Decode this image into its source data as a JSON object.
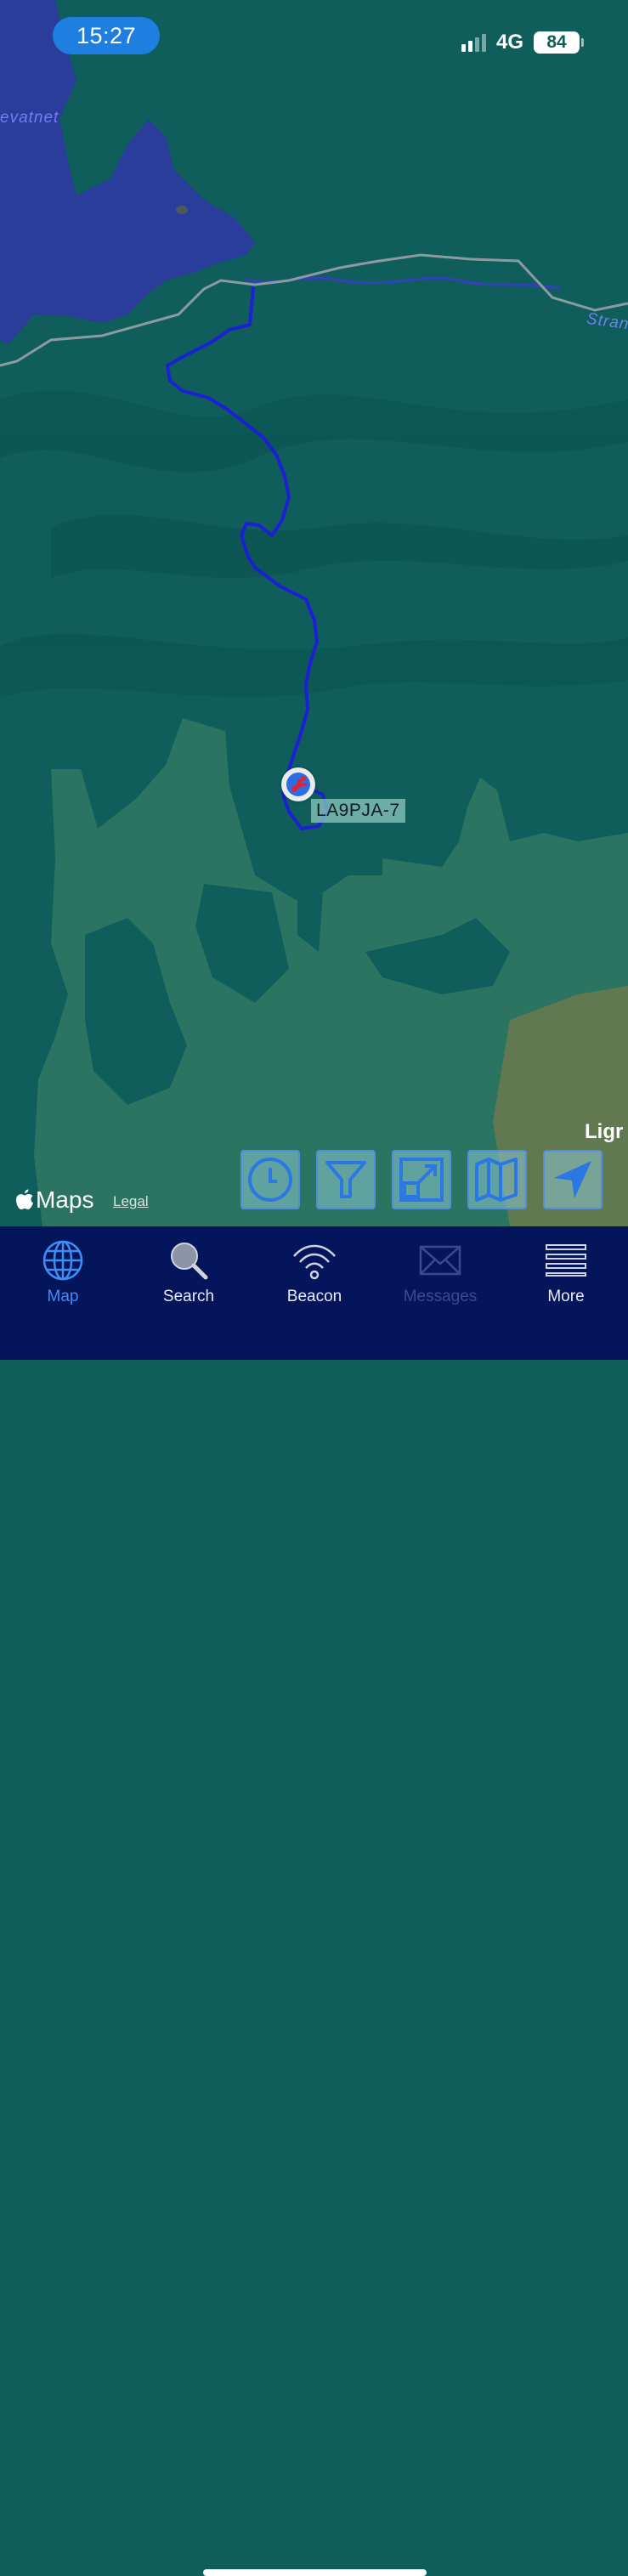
{
  "status_bar": {
    "time": "15:27",
    "network": "4G",
    "battery": "84",
    "signal_bars": 4,
    "signal_bars_active": 2
  },
  "map": {
    "place_labels": [
      "evatnet",
      "Stran",
      "Ligr"
    ],
    "station": {
      "callsign": "LA9PJA-7",
      "symbol": "red-skydiver-icon"
    },
    "attribution": {
      "provider": "Maps",
      "legal": "Legal"
    }
  },
  "map_tools": [
    {
      "name": "history-clock-icon"
    },
    {
      "name": "filter-funnel-icon"
    },
    {
      "name": "zoom-fit-icon"
    },
    {
      "name": "map-type-icon"
    },
    {
      "name": "locate-arrow-icon"
    }
  ],
  "tabbar": {
    "map": "Map",
    "search": "Search",
    "beacon": "Beacon",
    "messages": "Messages",
    "more": "More"
  },
  "colors": {
    "accent": "#3d8ef2",
    "track": "#1d1fd6",
    "tabbar_bg": "#05155c",
    "water": "#2a3d9a"
  }
}
